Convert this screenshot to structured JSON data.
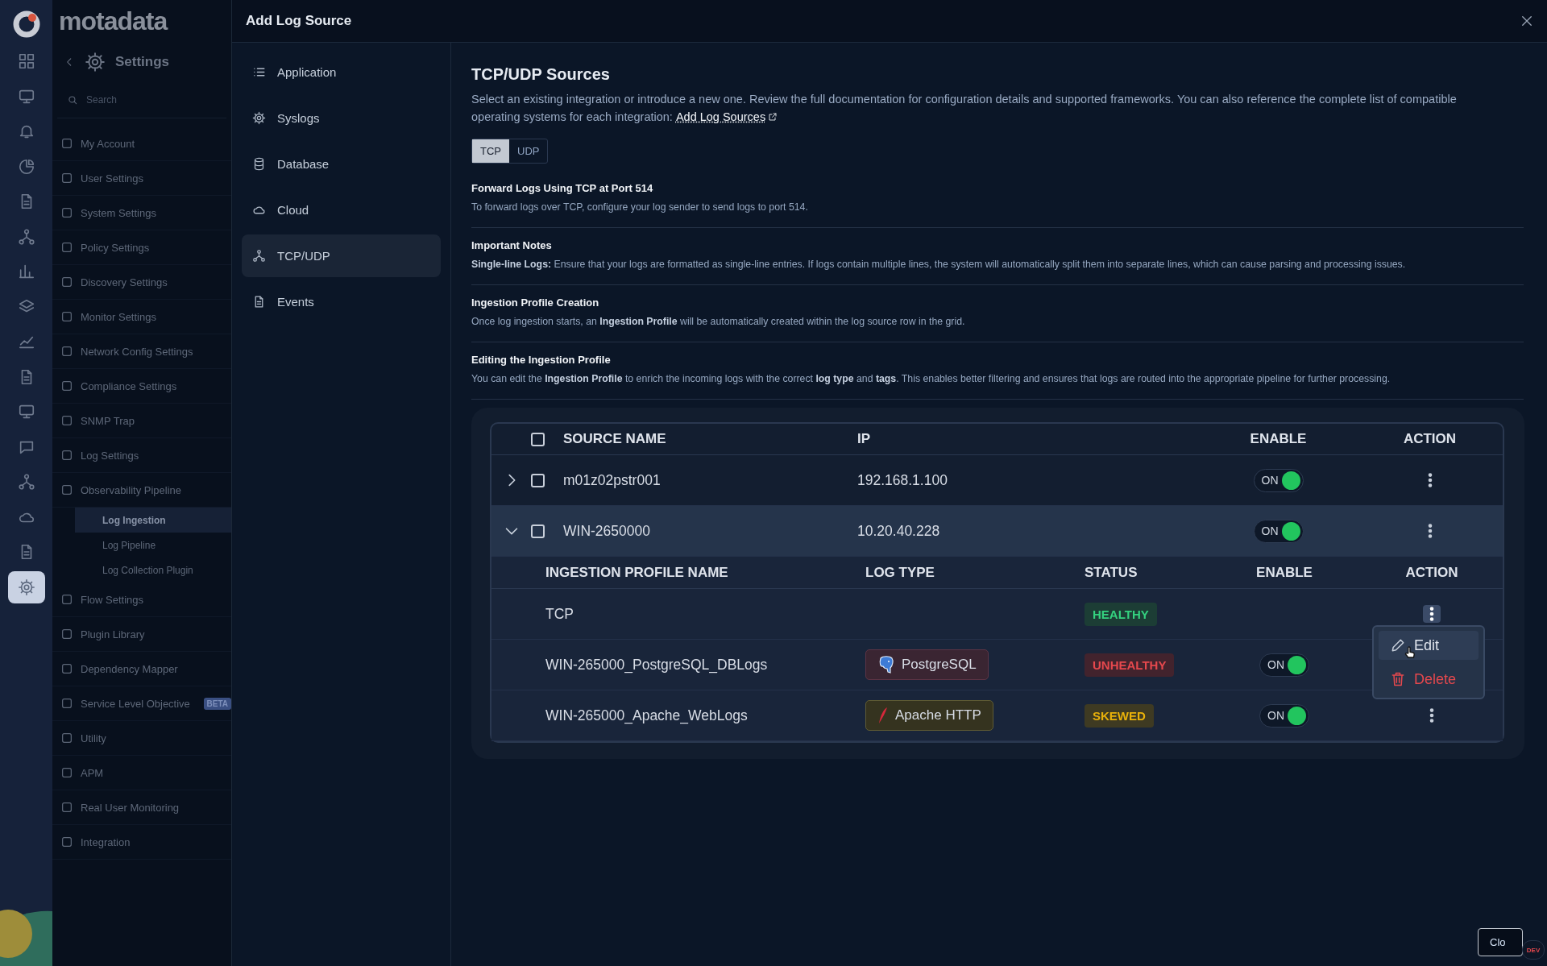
{
  "rail": {
    "items": [
      {
        "selected": false
      },
      {
        "selected": false
      },
      {
        "selected": false
      },
      {
        "selected": false
      },
      {
        "selected": false
      },
      {
        "selected": false
      },
      {
        "selected": false
      },
      {
        "selected": false
      },
      {
        "selected": false
      },
      {
        "selected": false
      },
      {
        "selected": false
      },
      {
        "selected": false
      },
      {
        "selected": false
      },
      {
        "selected": false
      },
      {
        "selected": false
      },
      {
        "selected": true
      }
    ]
  },
  "brand": {
    "logo_text": "motadata"
  },
  "settings_nav": {
    "title": "Settings",
    "search": {
      "placeholder": "Search"
    },
    "items": [
      {
        "label": "My Account",
        "selected": false
      },
      {
        "label": "User Settings",
        "selected": false
      },
      {
        "label": "System Settings",
        "selected": false
      },
      {
        "label": "Policy Settings",
        "selected": false
      },
      {
        "label": "Discovery Settings",
        "selected": false
      },
      {
        "label": "Monitor Settings",
        "selected": false
      },
      {
        "label": "Network Config Settings",
        "selected": false
      },
      {
        "label": "Compliance Settings",
        "selected": false
      },
      {
        "label": "SNMP Trap",
        "selected": false
      },
      {
        "label": "Log Settings",
        "selected": false
      },
      {
        "label": "Observability Pipeline",
        "selected": false,
        "expanded": true,
        "children": [
          {
            "label": "Log Ingestion",
            "selected": true
          },
          {
            "label": "Log Pipeline",
            "selected": false
          },
          {
            "label": "Log Collection Plugin",
            "selected": false
          }
        ]
      },
      {
        "label": "Flow Settings",
        "selected": false
      },
      {
        "label": "Plugin Library",
        "selected": false
      },
      {
        "label": "Dependency Mapper",
        "selected": false
      },
      {
        "label": "Service Level Objective",
        "selected": false,
        "badge": "BETA"
      },
      {
        "label": "Utility",
        "selected": false
      },
      {
        "label": "APM",
        "selected": false
      },
      {
        "label": "Real User Monitoring",
        "selected": false
      },
      {
        "label": "Integration",
        "selected": false
      }
    ]
  },
  "modal": {
    "title": "Add Log Source",
    "nav": [
      {
        "label": "Application",
        "selected": false
      },
      {
        "label": "Syslogs",
        "selected": false
      },
      {
        "label": "Database",
        "selected": false
      },
      {
        "label": "Cloud",
        "selected": false
      },
      {
        "label": "TCP/UDP",
        "selected": true
      },
      {
        "label": "Events",
        "selected": false
      }
    ],
    "heading": "TCP/UDP Sources",
    "intro": "Select an existing integration or introduce a new one. Review the full documentation for configuration details and supported frameworks. You can also reference the complete list of compatible operating systems for each integration:",
    "intro_link": "Add Log Sources",
    "protocol_tabs": [
      {
        "label": "TCP",
        "selected": true
      },
      {
        "label": "UDP",
        "selected": false
      }
    ],
    "sections": [
      {
        "title": "Forward Logs Using TCP at Port 514",
        "text": "To forward logs over TCP, configure your log sender to send logs to port 514."
      },
      {
        "title": "Important Notes",
        "text": "**Single-line Logs:** Ensure that your logs are formatted as single-line entries. If logs contain multiple lines, the system will automatically split them into separate lines, which can cause parsing and processing issues."
      },
      {
        "title": "Ingestion Profile Creation",
        "text": "Once log ingestion starts, an **Ingestion Profile** will be automatically created within the log source row in the grid."
      },
      {
        "title": "Editing the Ingestion Profile",
        "text": "You can edit the **Ingestion Profile** to enrich the incoming logs with the correct **log type** and **tags**. This enables better filtering and ensures that logs are routed into the appropriate pipeline for further processing."
      }
    ],
    "table": {
      "columns": [
        "SOURCE NAME",
        "IP",
        "ENABLE",
        "ACTION"
      ],
      "header_checked": false,
      "rows": [
        {
          "name": "m01z02pstr001",
          "ip": "192.168.1.100",
          "checked": false,
          "expanded": false,
          "enabled": true,
          "toggle_label": "ON"
        },
        {
          "name": "WIN-2650000",
          "ip": "10.20.40.228",
          "checked": false,
          "expanded": true,
          "enabled": true,
          "toggle_label": "ON",
          "profiles": {
            "columns": [
              "INGESTION PROFILE NAME",
              "LOG TYPE",
              "STATUS",
              "ENABLE",
              "ACTION"
            ],
            "rows": [
              {
                "name": "TCP",
                "status": "HEALTHY",
                "kind": "healthy",
                "menu_open": true
              },
              {
                "name": "WIN-265000_PostgreSQL_DBLogs",
                "log_type": {
                  "label": "PostgreSQL",
                  "kind": "postgres"
                },
                "status": "UNHEALTHY",
                "kind": "unhealthy",
                "enabled": true,
                "toggle_label": "ON",
                "menu_open": false
              },
              {
                "name": "WIN-265000_Apache_WebLogs",
                "log_type": {
                  "label": "Apache HTTP",
                  "kind": "apache"
                },
                "status": "SKEWED",
                "kind": "skewed",
                "enabled": true,
                "toggle_label": "ON",
                "menu_open": false
              }
            ]
          }
        }
      ]
    },
    "action_menu": {
      "items": [
        {
          "label": "Edit",
          "kind": "edit",
          "hovered": true
        },
        {
          "label": "Delete",
          "kind": "delete",
          "hovered": false
        }
      ]
    },
    "close_button": "Clo",
    "env_badge": "DEV"
  }
}
